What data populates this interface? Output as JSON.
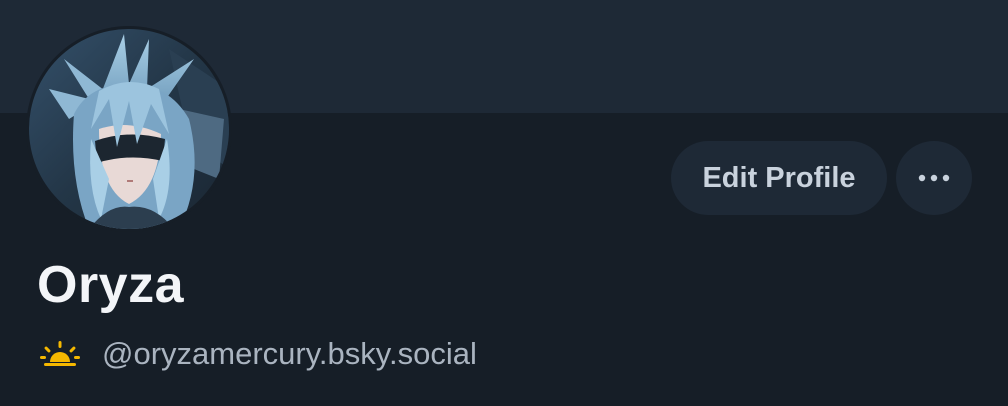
{
  "profile": {
    "display_name": "Oryza",
    "handle": "@oryzamercury.bsky.social",
    "handle_icon": "sunrise-emoji-icon",
    "avatar_icon": "anime-character-avatar"
  },
  "actions": {
    "edit_label": "Edit Profile",
    "more_icon": "ellipsis-icon"
  },
  "colors": {
    "background": "#161e27",
    "banner": "#1e2936",
    "button_bg": "#1e2936",
    "button_text": "#c9d2dd",
    "name_text": "#f3f5f8",
    "handle_text": "#aab4c0",
    "sun_icon": "#f5b800"
  }
}
